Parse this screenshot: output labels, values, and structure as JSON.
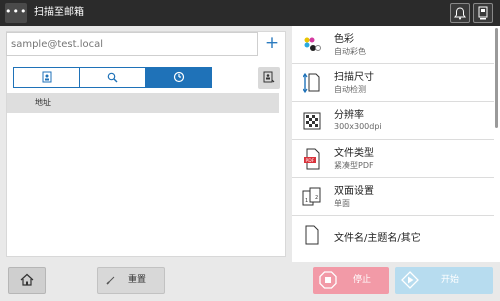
{
  "header": {
    "menu_icon": "ellipsis-icon",
    "title": "扫描至邮箱",
    "icons": [
      "bell-icon",
      "device-status-icon"
    ]
  },
  "address": {
    "placeholder": "sample@test.local",
    "add_label": "+"
  },
  "tabs": [
    {
      "icon": "address-book-icon",
      "active": false
    },
    {
      "icon": "search-icon",
      "active": false
    },
    {
      "icon": "history-clock-icon",
      "active": true
    }
  ],
  "side_icon": "direct-input-icon",
  "list": {
    "header": "地址"
  },
  "settings": [
    {
      "label": "色彩",
      "value": "自动彩色",
      "icon": "color-dots-icon"
    },
    {
      "label": "扫描尺寸",
      "value": "自动检测",
      "icon": "scan-size-icon"
    },
    {
      "label": "分辨率",
      "value": "300x300dpi",
      "icon": "resolution-icon"
    },
    {
      "label": "文件类型",
      "value": "紧凑型PDF",
      "icon": "pdf-file-icon"
    },
    {
      "label": "双面设置",
      "value": "单面",
      "icon": "duplex-icon"
    },
    {
      "label": "文件名/主题名/其它",
      "value": "",
      "icon": "document-icon"
    }
  ],
  "footer": {
    "home_icon": "home-icon",
    "reset_label": "重置",
    "stop_label": "停止",
    "start_label": "开始"
  },
  "colors": {
    "accent": "#1f72b8",
    "stop": "#f29aa7",
    "start": "#b7dcef",
    "topbar": "#2b2b2b"
  }
}
